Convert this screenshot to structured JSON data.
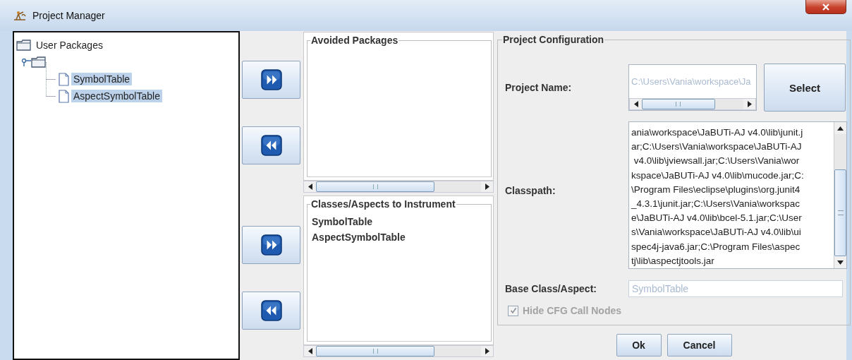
{
  "window": {
    "title": "Project Manager"
  },
  "tree": {
    "label": "User Packages",
    "children": [
      {
        "expanded": true,
        "children": [
          {
            "label": "SymbolTable",
            "selected": true
          },
          {
            "label": "AspectSymbolTable",
            "selected": true
          }
        ]
      }
    ]
  },
  "transfer_buttons": [
    {
      "kind": "add"
    },
    {
      "kind": "remove"
    },
    {
      "kind": "add"
    },
    {
      "kind": "remove"
    }
  ],
  "avoided_packages": {
    "title": "Avoided Packages"
  },
  "instrument": {
    "title": "Classes/Aspects to Instrument",
    "items": [
      "SymbolTable",
      "AspectSymbolTable"
    ]
  },
  "config": {
    "title": "Project Configuration",
    "project_name": {
      "label": "Project Name:",
      "value": "C:\\Users\\Vania\\workspace\\Ja",
      "disabled": true
    },
    "select_button": "Select",
    "classpath": {
      "label": "Classpath:",
      "lines": [
        "ania\\workspace\\JaBUTi-AJ v4.0\\lib\\junit.j",
        "ar;C:\\Users\\Vania\\workspace\\JaBUTi-AJ",
        " v4.0\\lib\\jviewsall.jar;C:\\Users\\Vania\\wor",
        "kspace\\JaBUTi-AJ v4.0\\lib\\mucode.jar;C:",
        "\\Program Files\\eclipse\\plugins\\org.junit4",
        "_4.3.1\\junit.jar;C:\\Users\\Vania\\workspac",
        "e\\JaBUTi-AJ v4.0\\lib\\bcel-5.1.jar;C:\\User",
        "s\\Vania\\workspace\\JaBUTi-AJ v4.0\\lib\\ui",
        "spec4j-java6.jar;C:\\Program Files\\aspec",
        "tj\\lib\\aspectjtools.jar"
      ]
    },
    "base_class": {
      "label": "Base Class/Aspect:",
      "value": "SymbolTable",
      "disabled": true
    },
    "hide_cfg": {
      "label": "Hide CFG Call Nodes",
      "checked": true,
      "disabled": true
    }
  },
  "buttons": [
    "Ok",
    "Cancel"
  ]
}
